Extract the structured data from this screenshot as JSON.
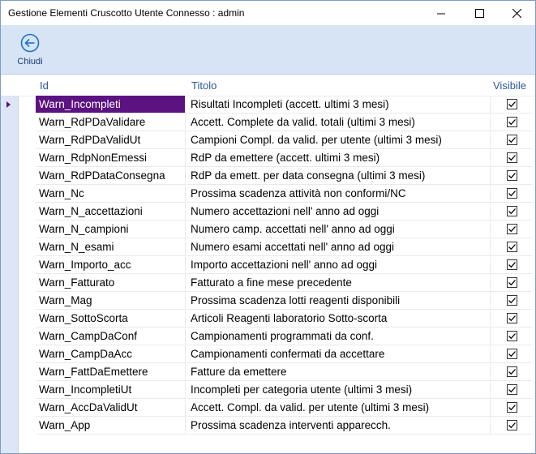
{
  "window": {
    "title": "Gestione Elementi Cruscotto Utente Connesso : admin"
  },
  "toolbar": {
    "close_label": "Chiudi"
  },
  "grid": {
    "columns": [
      "Id",
      "Titolo",
      "Visibile"
    ],
    "selected_index": 0,
    "rows": [
      {
        "id": "Warn_Incompleti",
        "title": "Risultati Incompleti (accett. ultimi 3 mesi)",
        "visible": true
      },
      {
        "id": "Warn_RdPDaValidare",
        "title": "Accett. Complete da valid. totali (ultimi 3 mesi)",
        "visible": true
      },
      {
        "id": "Warn_RdPDaValidUt",
        "title": "Campioni Compl. da valid. per utente (ultimi 3 mesi)",
        "visible": true
      },
      {
        "id": "Warn_RdpNonEmessi",
        "title": "RdP da emettere (accett. ultimi 3 mesi)",
        "visible": true
      },
      {
        "id": "Warn_RdPDataConsegna",
        "title": "RdP da emett. per data consegna (ultimi 3 mesi)",
        "visible": true
      },
      {
        "id": "Warn_Nc",
        "title": "Prossima scadenza attività non conformi/NC",
        "visible": true
      },
      {
        "id": "Warn_N_accettazioni",
        "title": "Numero accettazioni nell' anno ad oggi",
        "visible": true
      },
      {
        "id": "Warn_N_campioni",
        "title": "Numero camp. accettati nell' anno ad oggi",
        "visible": true
      },
      {
        "id": "Warn_N_esami",
        "title": "Numero esami accettati nell' anno ad oggi",
        "visible": true
      },
      {
        "id": "Warn_Importo_acc",
        "title": "Importo accettazioni nell' anno ad oggi",
        "visible": true
      },
      {
        "id": "Warn_Fatturato",
        "title": "Fatturato a fine mese precedente",
        "visible": true
      },
      {
        "id": "Warn_Mag",
        "title": "Prossima scadenza lotti reagenti disponibili",
        "visible": true
      },
      {
        "id": "Warn_SottoScorta",
        "title": "Articoli Reagenti laboratorio Sotto-scorta",
        "visible": true
      },
      {
        "id": "Warn_CampDaConf",
        "title": "Campionamenti programmati da conf.",
        "visible": true
      },
      {
        "id": "Warn_CampDaAcc",
        "title": "Campionamenti confermati da accettare",
        "visible": true
      },
      {
        "id": "Warn_FattDaEmettere",
        "title": "Fatture da emettere",
        "visible": true
      },
      {
        "id": "Warn_IncompletiUt",
        "title": "Incompleti per categoria utente (ultimi 3 mesi)",
        "visible": true
      },
      {
        "id": "Warn_AccDaValidUt",
        "title": "Accett. Compl. da valid. per utente (ultimi 3 mesi)",
        "visible": true
      },
      {
        "id": "Warn_App",
        "title": "Prossima scadenza interventi apparecch.",
        "visible": true
      }
    ]
  },
  "colors": {
    "selection": "#5c1280",
    "header_text": "#2b579a",
    "toolbar_bg": "#d6e4f5",
    "icon_blue": "#1e6fd0"
  }
}
